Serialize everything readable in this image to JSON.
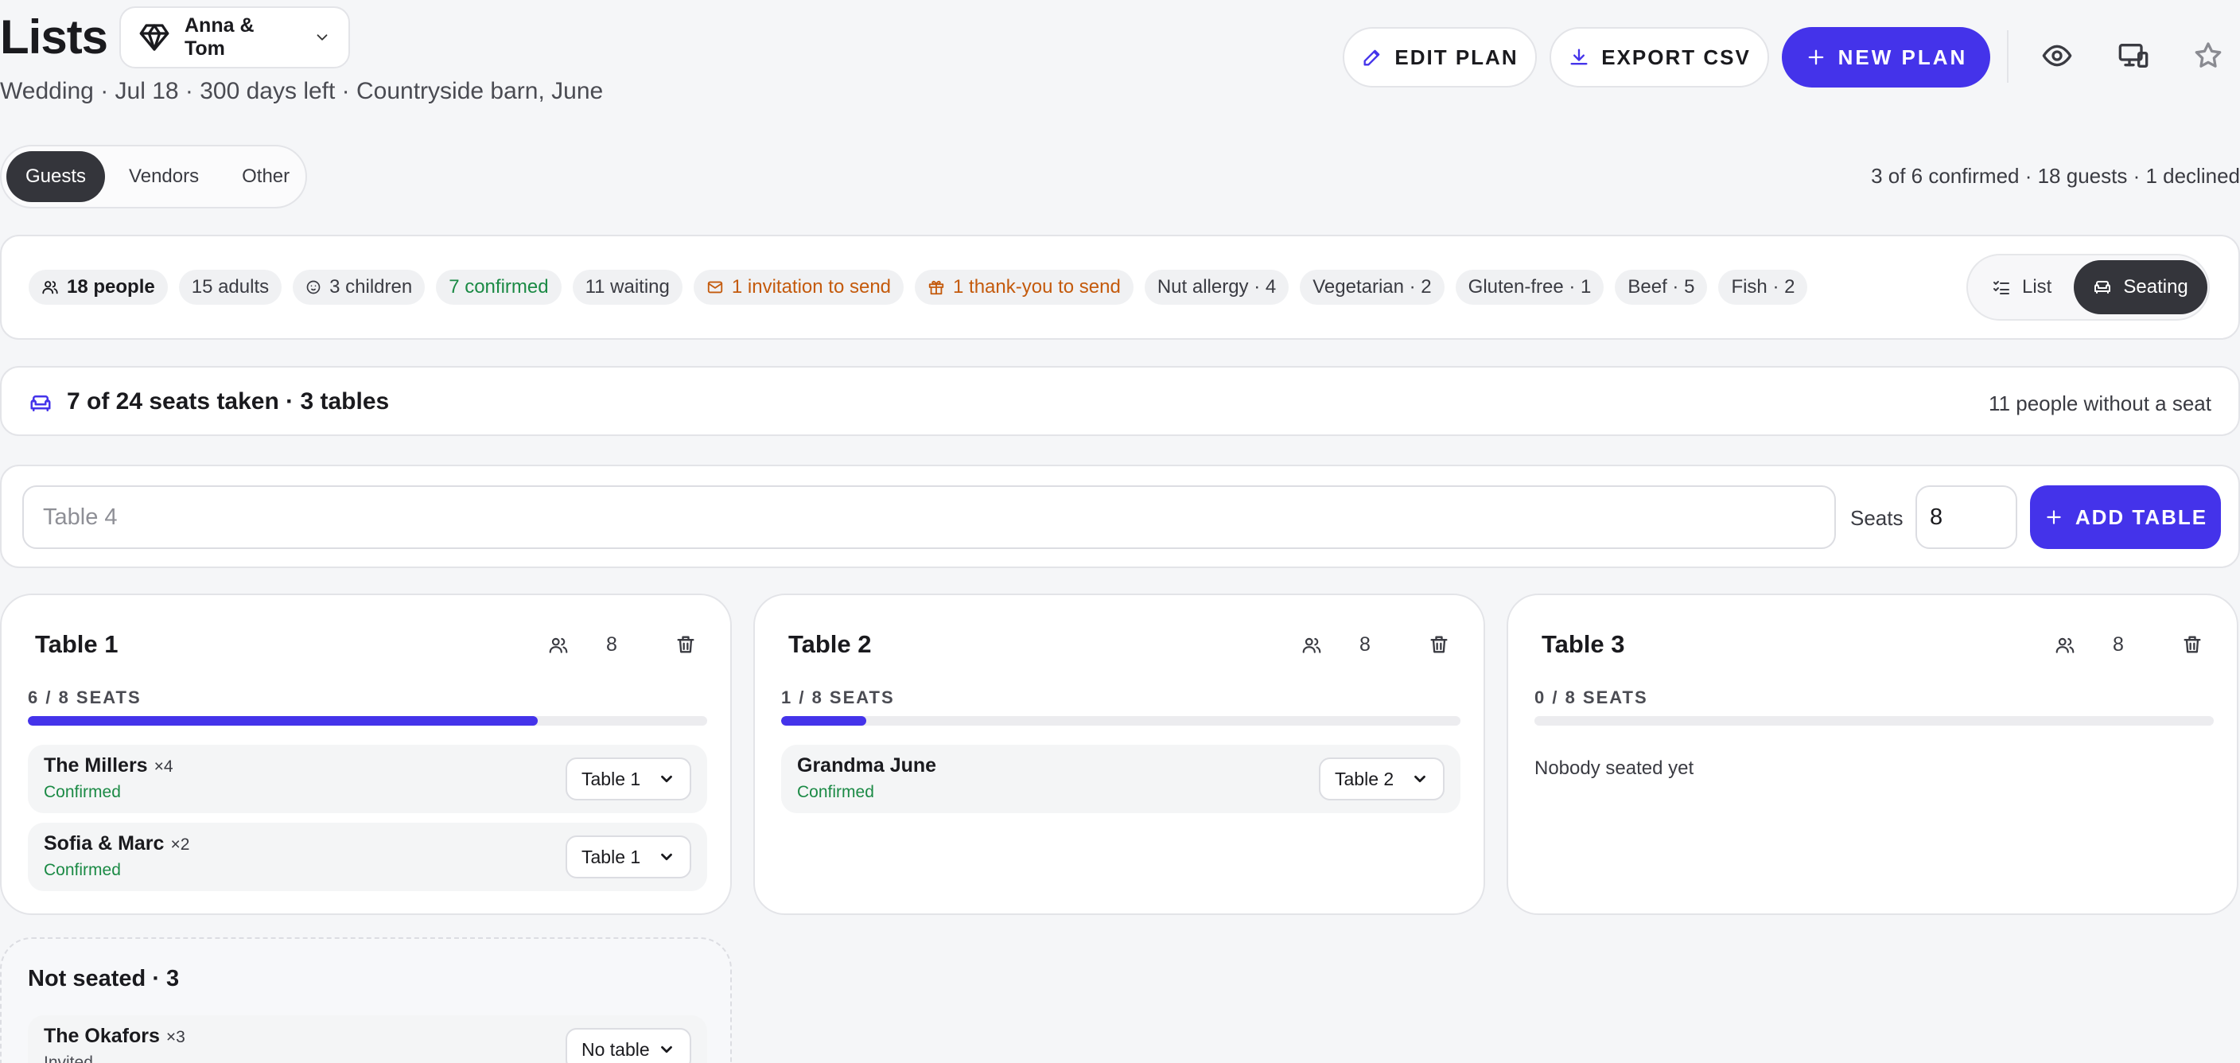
{
  "header": {
    "title": "Lists",
    "plan_selector": {
      "value": "Anna & Tom",
      "icon": "diamond-icon"
    },
    "subtitle": "Wedding · Jul 18 · 300 days left · Countryside barn, June",
    "buttons": {
      "edit_plan": "EDIT PLAN",
      "export_csv": "EXPORT CSV",
      "new_plan": "NEW PLAN"
    },
    "icons": [
      "eye-icon",
      "devices-icon",
      "star-icon"
    ]
  },
  "tabs": {
    "items": [
      {
        "label": "Guests",
        "active": true
      },
      {
        "label": "Vendors",
        "active": false
      },
      {
        "label": "Other",
        "active": false
      }
    ],
    "summary": "3 of 6 confirmed · 18 guests · 1 declined"
  },
  "stats": {
    "chips": [
      {
        "label": "18 people",
        "style": "bold",
        "icon": "people-icon"
      },
      {
        "label": "15 adults",
        "style": "plain"
      },
      {
        "label": "3 children",
        "style": "plain",
        "icon": "baby-icon"
      },
      {
        "label": "7 confirmed",
        "style": "green"
      },
      {
        "label": "11 waiting",
        "style": "plain"
      },
      {
        "label": "1 invitation to send",
        "style": "orange",
        "icon": "mail-icon"
      },
      {
        "label": "1 thank-you to send",
        "style": "orange",
        "icon": "gift-icon"
      },
      {
        "label": "Nut allergy · 4",
        "style": "plain"
      },
      {
        "label": "Vegetarian · 2",
        "style": "plain"
      },
      {
        "label": "Gluten-free · 1",
        "style": "plain"
      },
      {
        "label": "Beef · 5",
        "style": "plain"
      },
      {
        "label": "Fish · 2",
        "style": "plain"
      }
    ],
    "view_toggle": {
      "list": "List",
      "seating": "Seating",
      "active": "seating"
    }
  },
  "seating_summary": {
    "title": "7 of 24 seats taken · 3 tables",
    "unseated": "11 people without a seat"
  },
  "add_table": {
    "name_placeholder": "Table 4",
    "seats_label": "Seats",
    "seats_value": "8",
    "button": "ADD TABLE"
  },
  "tables": [
    {
      "name": "Table 1",
      "capacity": "8",
      "seats_label": "6 / 8 SEATS",
      "fill": 0.75,
      "guests": [
        {
          "name": "The Millers",
          "count": "×4",
          "status": "Confirmed",
          "table": "Table 1"
        },
        {
          "name": "Sofia & Marc",
          "count": "×2",
          "status": "Confirmed",
          "table": "Table 1"
        }
      ]
    },
    {
      "name": "Table 2",
      "capacity": "8",
      "seats_label": "1 / 8 SEATS",
      "fill": 0.125,
      "guests": [
        {
          "name": "Grandma June",
          "count": "",
          "status": "Confirmed",
          "table": "Table 2"
        }
      ]
    },
    {
      "name": "Table 3",
      "capacity": "8",
      "seats_label": "0 / 8 SEATS",
      "fill": 0,
      "guests": [],
      "empty": "Nobody seated yet"
    }
  ],
  "not_seated": {
    "title": "Not seated · 3",
    "guests": [
      {
        "name": "The Okafors",
        "count": "×3",
        "status": "Invited",
        "table": "No table"
      }
    ]
  },
  "colors": {
    "accent": "#4433ea",
    "confirmed": "#1b8a45",
    "pending": "#c45a0c",
    "dark": "#34353b"
  }
}
